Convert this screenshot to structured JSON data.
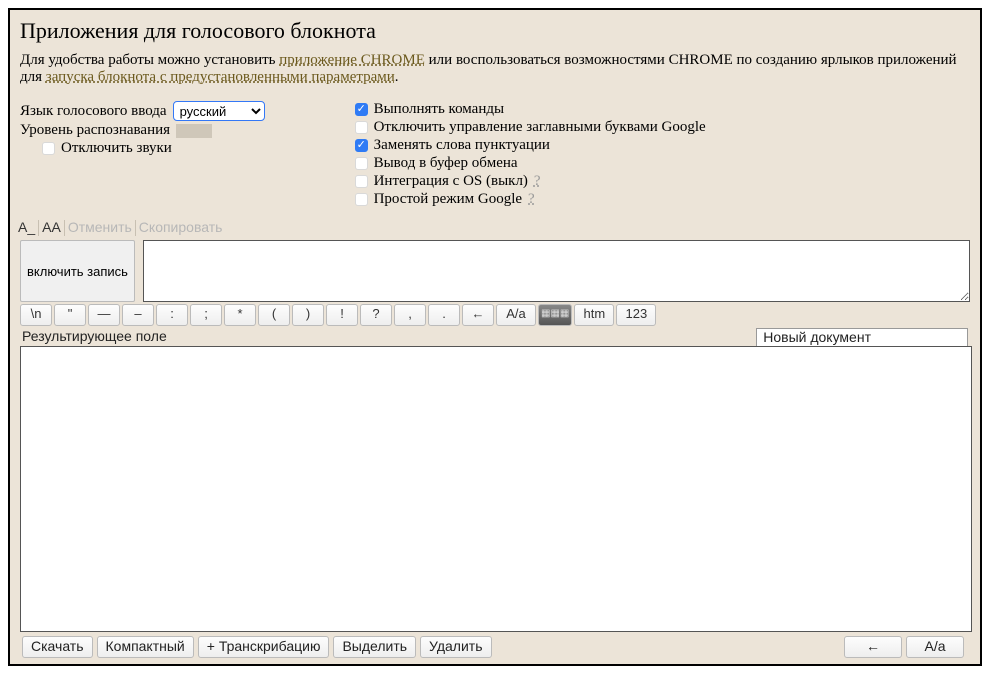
{
  "title": "Приложения для голосового блокнота",
  "intro": {
    "t1": "Для удобства работы можно установить ",
    "link1": "приложение CHROME",
    "t2": " или воспользоваться возможностями CHROME по созданию ярлыков приложений для ",
    "link2": "запуска блокнота с предустановленными параметрами",
    "t3": "."
  },
  "lang_label": "Язык голосового ввода",
  "lang_value": "русский",
  "level_label": "Уровень распознавания",
  "disable_sounds": "Отключить звуки",
  "opts": {
    "exec": "Выполнять команды",
    "caps": "Отключить управление заглавными буквами Google",
    "punct": "Заменять слова пунктуации",
    "clip": "Вывод в буфер обмена",
    "os": "Интеграция с OS (выкл)",
    "simple": "Простой режим Google"
  },
  "checks": {
    "exec": true,
    "caps": false,
    "punct": true,
    "clip": false,
    "os": false,
    "simple": false,
    "sounds": false
  },
  "q": "?",
  "tb1": {
    "a1": "A_",
    "a2": "AA",
    "undo": "Отменить",
    "copy": "Скопировать"
  },
  "record": "включить запись",
  "syms": [
    "\\n",
    "\"",
    "—",
    "–",
    ":",
    ";",
    "*",
    "(",
    ")",
    "!",
    "?",
    ",",
    ".",
    "←",
    "A/a",
    "⌨",
    "htm",
    "123"
  ],
  "result_label": "Результирующее поле",
  "newdoc": "Новый документ",
  "bottom": {
    "download": "Скачать",
    "compact": "Компактный",
    "transcr": "+ Транскрибацию",
    "select": "Выделить",
    "delete": "Удалить",
    "back": "←",
    "case": "A/a"
  }
}
